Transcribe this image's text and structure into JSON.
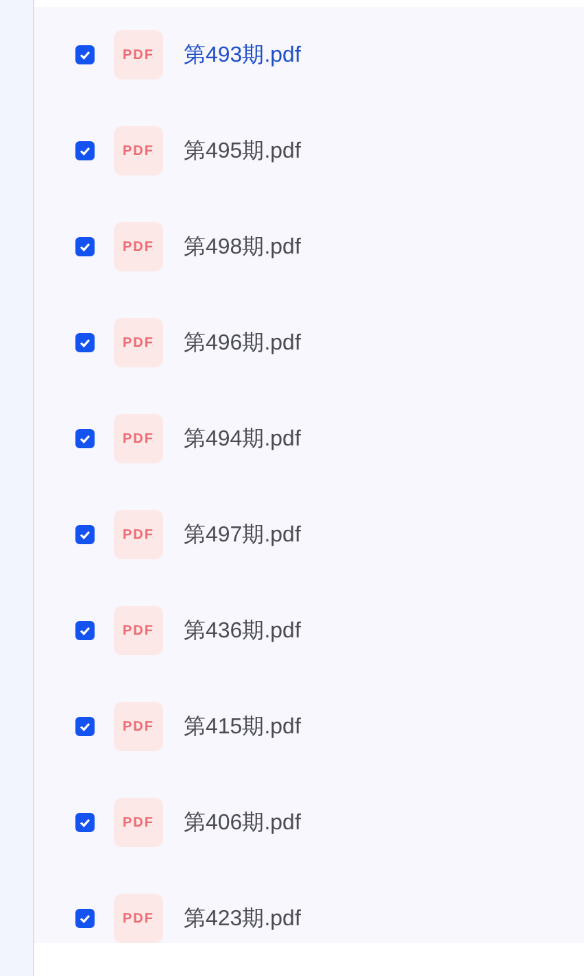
{
  "files": [
    {
      "name": "第493期.pdf",
      "icon_label": "PDF",
      "checked": true,
      "active": true
    },
    {
      "name": "第495期.pdf",
      "icon_label": "PDF",
      "checked": true,
      "active": false
    },
    {
      "name": "第498期.pdf",
      "icon_label": "PDF",
      "checked": true,
      "active": false
    },
    {
      "name": "第496期.pdf",
      "icon_label": "PDF",
      "checked": true,
      "active": false
    },
    {
      "name": "第494期.pdf",
      "icon_label": "PDF",
      "checked": true,
      "active": false
    },
    {
      "name": "第497期.pdf",
      "icon_label": "PDF",
      "checked": true,
      "active": false
    },
    {
      "name": "第436期.pdf",
      "icon_label": "PDF",
      "checked": true,
      "active": false
    },
    {
      "name": "第415期.pdf",
      "icon_label": "PDF",
      "checked": true,
      "active": false
    },
    {
      "name": "第406期.pdf",
      "icon_label": "PDF",
      "checked": true,
      "active": false
    },
    {
      "name": "第423期.pdf",
      "icon_label": "PDF",
      "checked": true,
      "active": false
    }
  ]
}
